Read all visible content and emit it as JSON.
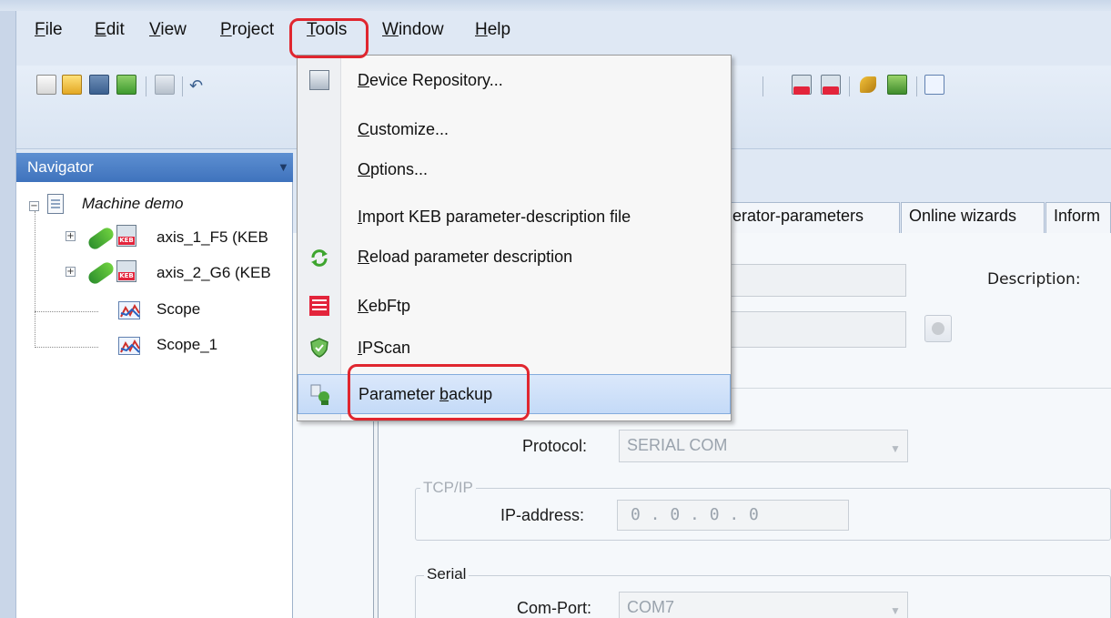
{
  "menu": {
    "file": {
      "u": "F",
      "rest": "ile"
    },
    "edit": {
      "u": "E",
      "rest": "dit"
    },
    "view": {
      "u": "V",
      "rest": "iew"
    },
    "project": {
      "u": "P",
      "rest": "roject"
    },
    "tools": {
      "u": "T",
      "rest": "ools"
    },
    "window": {
      "u": "W",
      "rest": "indow"
    },
    "help": {
      "u": "H",
      "rest": "elp"
    }
  },
  "tools_menu": {
    "device_repository": {
      "u": "D",
      "rest": "evice Repository..."
    },
    "customize": {
      "u": "C",
      "rest": "ustomize..."
    },
    "options": {
      "u": "O",
      "rest": "ptions..."
    },
    "import_keb": {
      "u": "I",
      "rest": "mport KEB parameter-description file"
    },
    "reload": {
      "u": "R",
      "rest": "eload parameter description"
    },
    "kebftp": {
      "u": "K",
      "rest": "ebFtp"
    },
    "ipscan": {
      "u": "I",
      "rest": "PScan"
    },
    "parameter_backup": {
      "pre": "Parameter ",
      "u": "b",
      "rest": "ackup"
    }
  },
  "navigator": {
    "title": "Navigator",
    "root": "Machine demo",
    "items": [
      "axis_1_F5 (KEB",
      "axis_2_G6 (KEB",
      "Scope",
      "Scope_1"
    ]
  },
  "tabs": [
    "erator-parameters",
    "Online wizards",
    "Inform"
  ],
  "form": {
    "description_label": "Description:",
    "protocol_label": "Protocol:",
    "protocol_value": "SERIAL COM",
    "tcpip_group": "TCP/IP",
    "ip_label": "IP-address:",
    "ip_value": "0 . 0 . 0 . 0",
    "serial_group": "Serial",
    "comport_label": "Com-Port:",
    "comport_value": "COM7"
  },
  "colors": {
    "highlight": "#e0262f",
    "selected_item": "#c4daf7",
    "navigator_header": "#3f73bd"
  }
}
